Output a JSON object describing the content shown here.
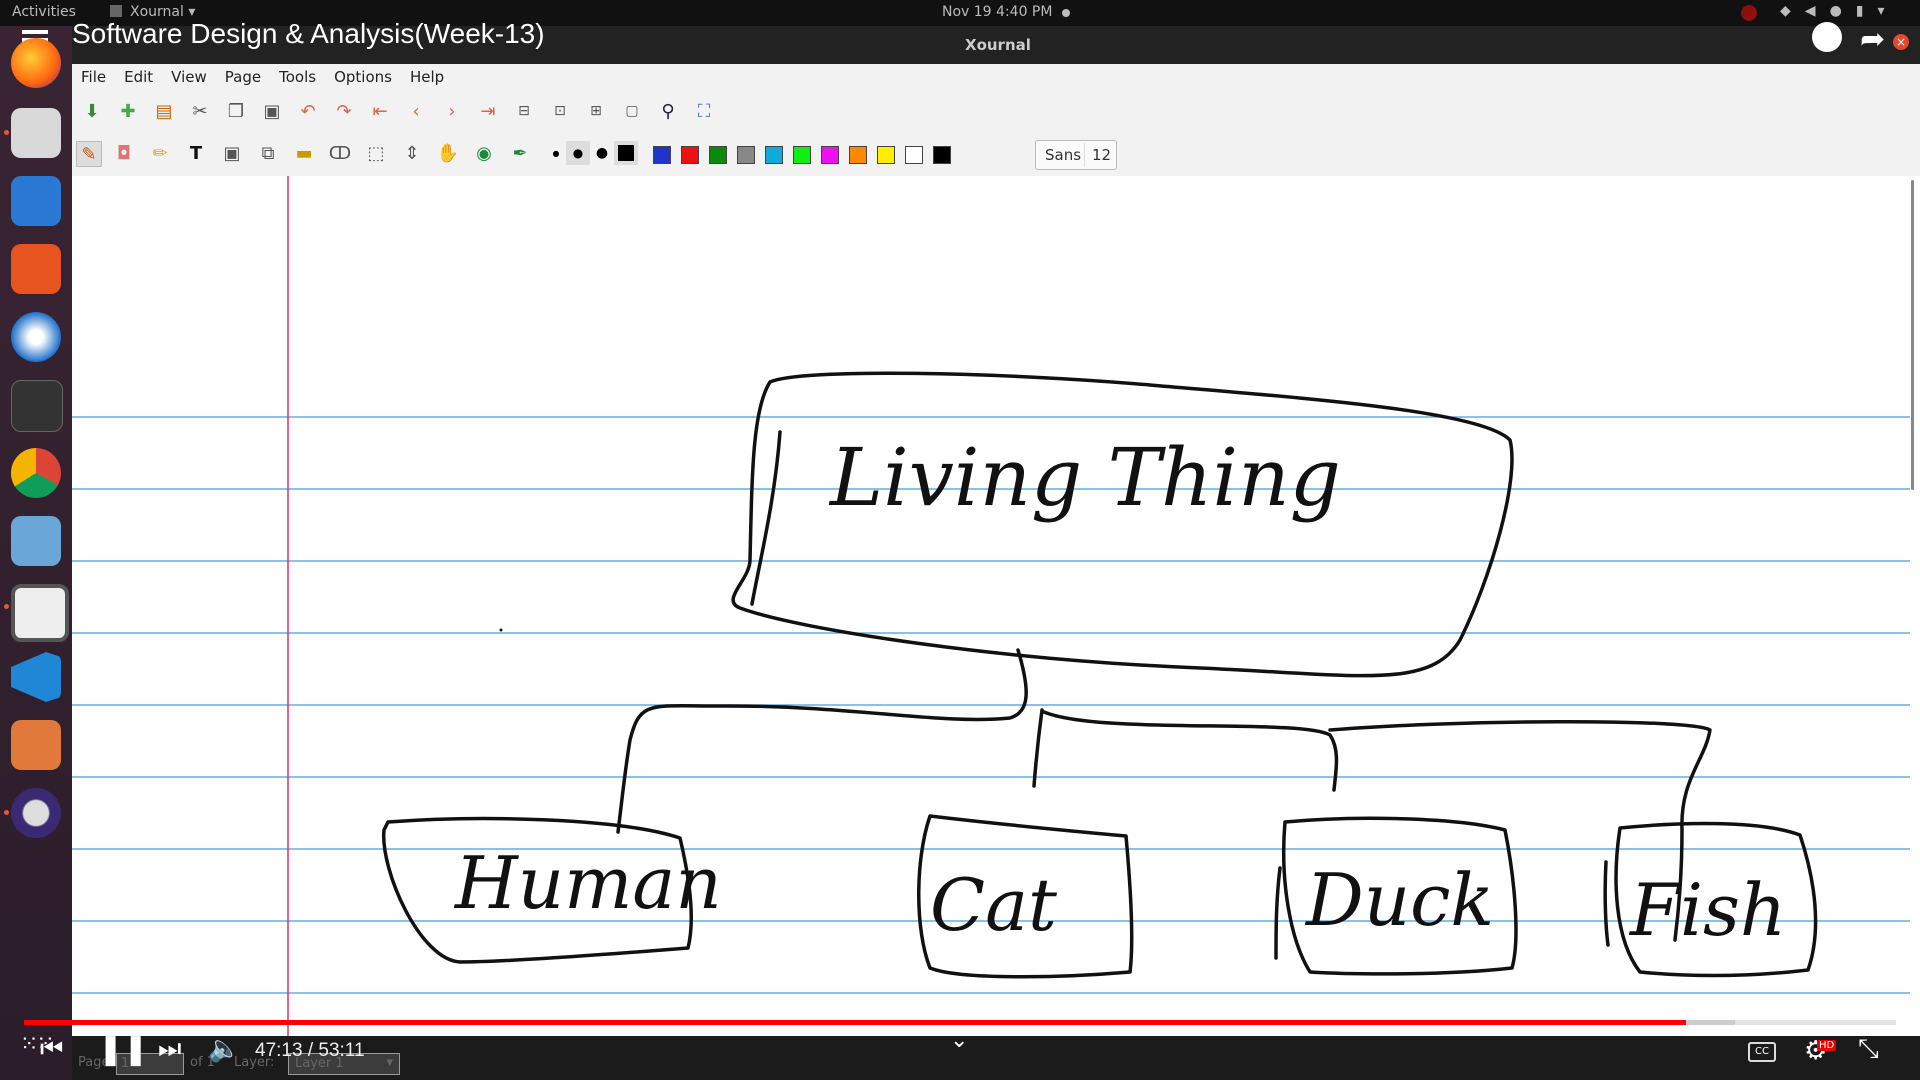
{
  "topbar": {
    "activities": "Activities",
    "app_name": "Xournal",
    "clock": "Nov 19  4:40 PM"
  },
  "video": {
    "title": "Software Design & Analysis(Week-13)",
    "current_time": "47:13",
    "duration": "53:11",
    "time_display": "47:13 / 53:11",
    "played_fraction": 0.8878,
    "buffered_fraction": 0.914
  },
  "window": {
    "title": "Xournal"
  },
  "menubar": [
    "File",
    "Edit",
    "View",
    "Page",
    "Tools",
    "Options",
    "Help"
  ],
  "toolbar": {
    "font_name": "Sans",
    "font_size": "12",
    "colors": [
      "#2233cc",
      "#ee1111",
      "#0a8a0a",
      "#888888",
      "#11aadd",
      "#11ee11",
      "#ee11ee",
      "#ff8800",
      "#ffee00",
      "#ffffff",
      "#000000"
    ]
  },
  "diagram": {
    "root": "Living Thing",
    "children": [
      "Human",
      "Cat",
      "Duck",
      "Fish"
    ]
  },
  "statusbar": {
    "page_label": "Page",
    "page_value": "1",
    "of_label": "of 1",
    "layer_label": "Layer:",
    "layer_value": "Layer 1"
  },
  "icons": {
    "dock": [
      "firefox-icon",
      "files-icon",
      "writer-icon",
      "app-center-icon",
      "thunderbird-icon",
      "terminal-icon",
      "chrome-icon",
      "screen-recorder-icon",
      "xournal-icon",
      "vscode-icon",
      "impress-icon",
      "eclipse-icon"
    ]
  }
}
